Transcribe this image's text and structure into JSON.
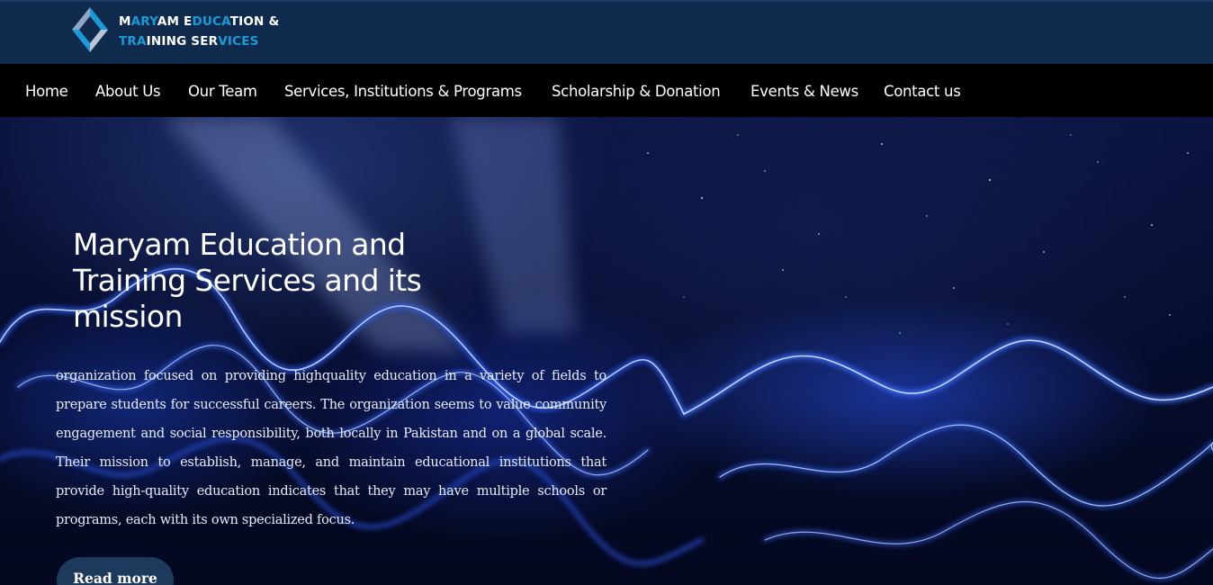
{
  "brand": {
    "line1_segments": [
      {
        "text": "M",
        "color": "white"
      },
      {
        "text": "ARY",
        "color": "blue"
      },
      {
        "text": "AM E",
        "color": "white"
      },
      {
        "text": "DUCA",
        "color": "blue"
      },
      {
        "text": "TION &",
        "color": "white"
      }
    ],
    "line2_segments": [
      {
        "text": "TRA",
        "color": "blue"
      },
      {
        "text": "INING SER",
        "color": "white"
      },
      {
        "text": "VICES",
        "color": "blue"
      }
    ],
    "icon": "logo-diamond-icon",
    "colors": {
      "white": "#ffffff",
      "blue": "#1a9bd7"
    }
  },
  "nav": {
    "items": [
      {
        "label": "Home"
      },
      {
        "label": "About Us"
      },
      {
        "label": "Our Team"
      },
      {
        "label": "Services, Institutions & Programs"
      },
      {
        "label": "Scholarship & Donation"
      },
      {
        "label": "Events & News"
      },
      {
        "label": "Contact us"
      }
    ]
  },
  "hero": {
    "title": "Maryam Education and Training Services and its mission",
    "body": "organization focused on providing highquality education in a variety of fields to prepare students for successful careers. The organization seems to value community engagement and social responsibility, both locally in Pakistan and on a global scale. Their mission to establish, manage, and maintain educational institutions that provide high-quality education indicates that they may have multiple schools or programs, each with its own specialized focus.",
    "button_label": "Read more"
  },
  "colors": {
    "topbar": "#0f2a4d",
    "navbar": "#000000",
    "button": "#1d3a5c",
    "accent": "#1a9bd7"
  }
}
